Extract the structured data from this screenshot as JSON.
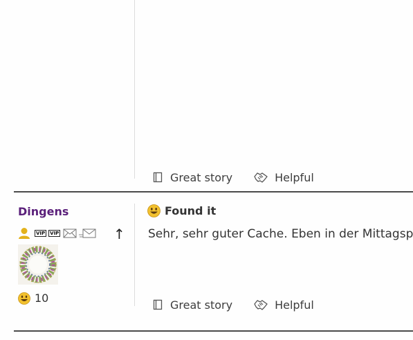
{
  "entries": [
    {
      "actions": {
        "great_story_label": "Great story",
        "helpful_label": "Helpful"
      }
    },
    {
      "user": {
        "name": "Dingens",
        "badges": [
          "person-icon",
          "VIP",
          "VIP",
          "mail-icon",
          "mail-send-icon"
        ],
        "vip_label": "VIP",
        "found_count": "10",
        "avatar": "floral-wreath-avatar"
      },
      "log": {
        "type_label": "Found it",
        "text": "Sehr, sehr guter Cache. Eben in der Mittagspa"
      },
      "actions": {
        "great_story_label": "Great story",
        "helpful_label": "Helpful"
      },
      "scroll_up_label": "↑"
    }
  ],
  "colors": {
    "username": "#5a1f7a",
    "divider": "#4a4a4a",
    "smiley": "#f2c12e"
  }
}
